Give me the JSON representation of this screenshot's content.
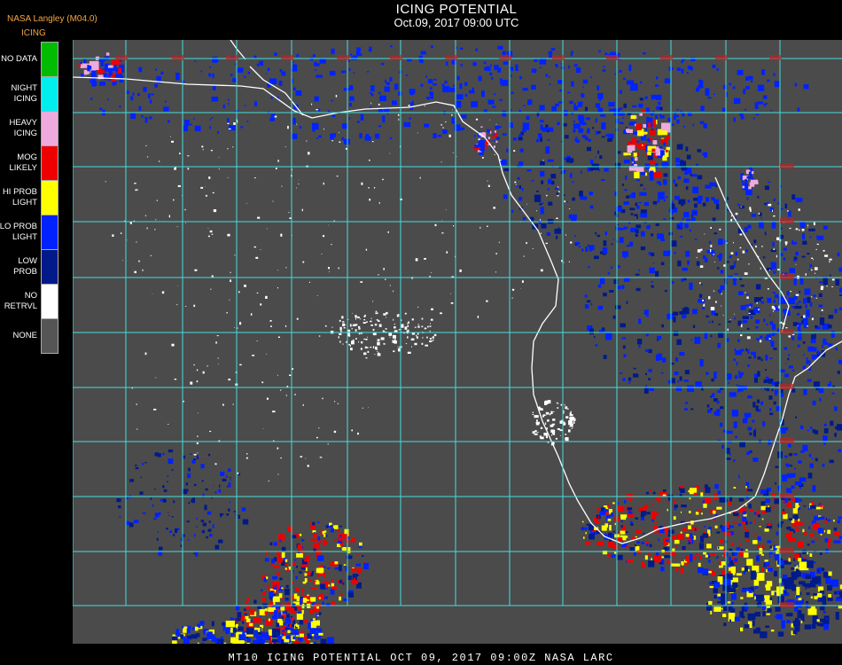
{
  "header": {
    "title": "ICING POTENTIAL",
    "datetime": "Oct.09, 2017 09:00 UTC",
    "source": "NASA Langley (M04.0)",
    "product": "ICING"
  },
  "legend": [
    {
      "lines": [
        "NO DATA"
      ],
      "color": "#00bb00"
    },
    {
      "lines": [
        "NIGHT",
        "ICING"
      ],
      "color": "#00eeee"
    },
    {
      "lines": [
        "HEAVY",
        "ICING"
      ],
      "color": "#eeaadd"
    },
    {
      "lines": [
        "MOG",
        "LIKELY"
      ],
      "color": "#ee0000"
    },
    {
      "lines": [
        "HI PROB",
        "LIGHT"
      ],
      "color": "#ffff00"
    },
    {
      "lines": [
        "LO PROB",
        "LIGHT"
      ],
      "color": "#0022ff"
    },
    {
      "lines": [
        "LOW",
        "PROB"
      ],
      "color": "#001a8a"
    },
    {
      "lines": [
        "NO",
        "RETRVL"
      ],
      "color": "#ffffff"
    },
    {
      "lines": [
        "NONE"
      ],
      "color": "#555555"
    }
  ],
  "map": {
    "background": "#4b4b4b",
    "grid_color": "#44dddd",
    "coast_color": "#ffffff",
    "label_color": "#bb2222"
  },
  "footer": "MT10  ICING POTENTIAL   OCT 09, 2017 09:00Z   NASA LARC"
}
